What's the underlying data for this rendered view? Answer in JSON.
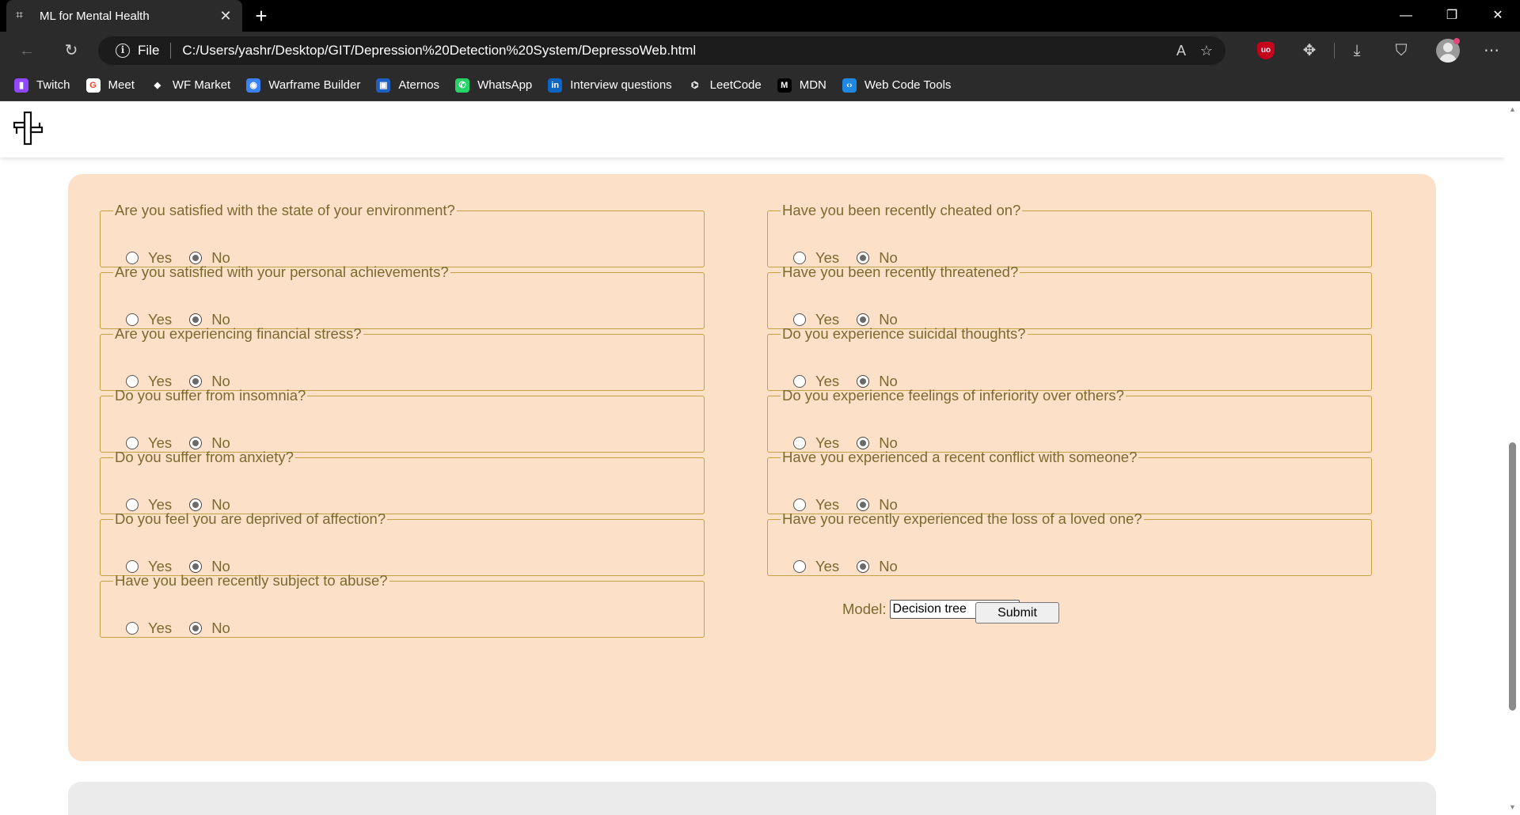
{
  "browser": {
    "tab_title": "ML for Mental Health",
    "address": {
      "scheme_label": "File",
      "url": "C:/Users/yashr/Desktop/GIT/Depression%20Detection%20System/DepressoWeb.html"
    },
    "bookmarks": [
      {
        "label": "Twitch",
        "icon": "twitch-icon",
        "color": "#9146ff"
      },
      {
        "label": "Meet",
        "icon": "google-icon",
        "color": "#ffffff"
      },
      {
        "label": "WF Market",
        "icon": "wf-market-icon",
        "color": "#2b2b2b"
      },
      {
        "label": "Warframe Builder",
        "icon": "warframe-builder-icon",
        "color": "#3b82f6"
      },
      {
        "label": "Aternos",
        "icon": "aternos-icon",
        "color": "#1e5fbf"
      },
      {
        "label": "WhatsApp",
        "icon": "whatsapp-icon",
        "color": "#25d366"
      },
      {
        "label": "Interview questions",
        "icon": "linkedin-icon",
        "color": "#0a66c2"
      },
      {
        "label": "LeetCode",
        "icon": "leetcode-icon",
        "color": "#2b2b2b"
      },
      {
        "label": "MDN",
        "icon": "mdn-icon",
        "color": "#000000"
      },
      {
        "label": "Web Code Tools",
        "icon": "web-code-tools-icon",
        "color": "#1e88e5"
      }
    ]
  },
  "form": {
    "questions_left": [
      {
        "question": "Are you satisfied with the state of your environment?",
        "yes": "Yes",
        "no": "No",
        "selected": "No"
      },
      {
        "question": "Are you satisfied with your personal achievements?",
        "yes": "Yes",
        "no": "No",
        "selected": "No"
      },
      {
        "question": "Are you experiencing financial stress?",
        "yes": "Yes",
        "no": "No",
        "selected": "No"
      },
      {
        "question": "Do you suffer from insomnia?",
        "yes": "Yes",
        "no": "No",
        "selected": "No"
      },
      {
        "question": "Do you suffer from anxiety?",
        "yes": "Yes",
        "no": "No",
        "selected": "No"
      },
      {
        "question": "Do you feel you are deprived of affection?",
        "yes": "Yes",
        "no": "No",
        "selected": "No"
      },
      {
        "question": "Have you been recently subject to abuse?",
        "yes": "Yes",
        "no": "No",
        "selected": "No"
      }
    ],
    "questions_right": [
      {
        "question": "Have you been recently cheated on?",
        "yes": "Yes",
        "no": "No",
        "selected": "No"
      },
      {
        "question": "Have you been recently threatened?",
        "yes": "Yes",
        "no": "No",
        "selected": "No"
      },
      {
        "question": "Do you experience suicidal thoughts?",
        "yes": "Yes",
        "no": "No",
        "selected": "No"
      },
      {
        "question": "Do you experience feelings of inferiority over others?",
        "yes": "Yes",
        "no": "No",
        "selected": "No"
      },
      {
        "question": "Have you experienced a recent conflict with someone?",
        "yes": "Yes",
        "no": "No",
        "selected": "No"
      },
      {
        "question": "Have you recently experienced the loss of a loved one?",
        "yes": "Yes",
        "no": "No",
        "selected": "No"
      }
    ],
    "model_label": "Model:",
    "model_selected": "Decision tree",
    "submit_label": "Submit"
  },
  "colors": {
    "form_background": "#fde0c8",
    "field_border": "#c9a042",
    "text": "#7a6a30"
  }
}
